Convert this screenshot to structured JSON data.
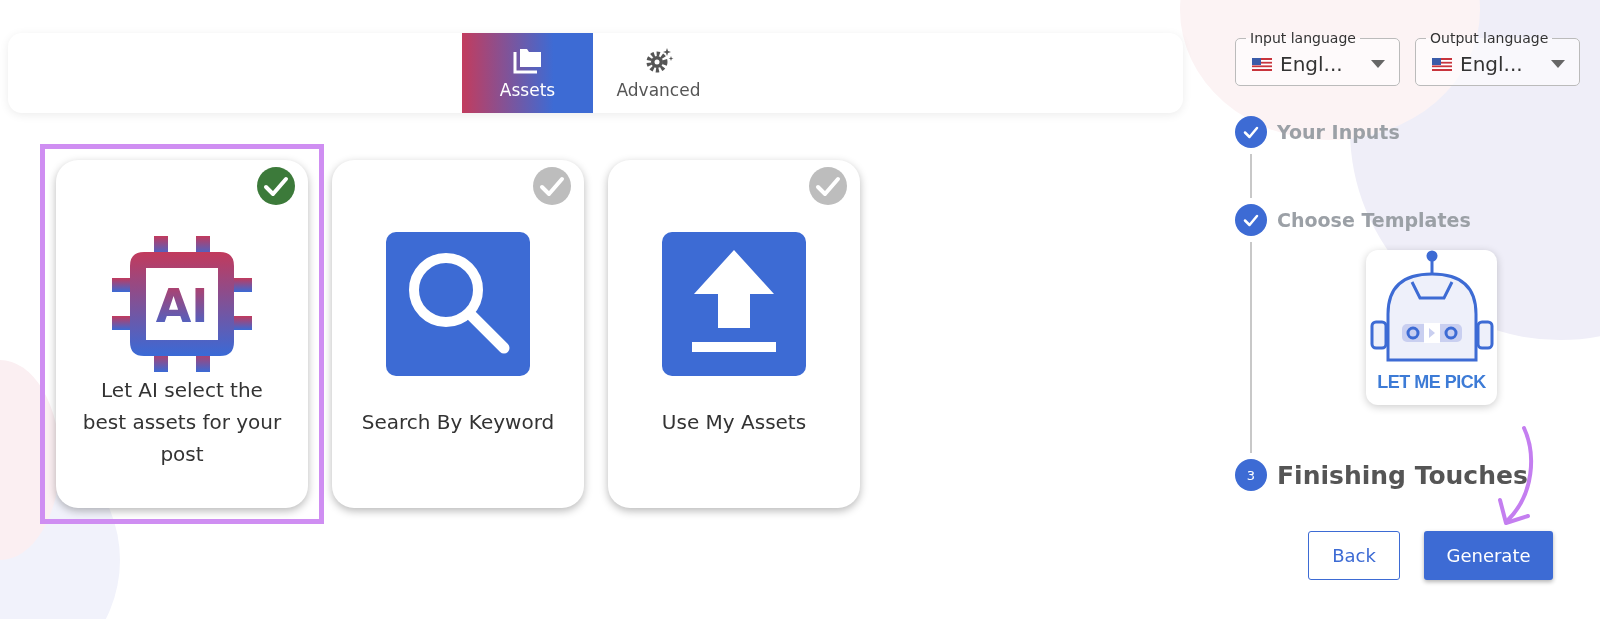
{
  "tabs": [
    {
      "label": "Assets",
      "kind": "folders",
      "selected": true
    },
    {
      "label": "Advanced",
      "kind": "gears",
      "selected": false
    }
  ],
  "options": [
    {
      "kind": "ai",
      "label": "Let AI select the best assets for your post",
      "icon_text": "AI",
      "checked": true,
      "highlighted": true
    },
    {
      "kind": "search",
      "label": "Search By Keyword",
      "checked": false,
      "highlighted": false
    },
    {
      "kind": "upload",
      "label": "Use My Assets",
      "checked": false,
      "highlighted": false
    }
  ],
  "languages": [
    {
      "label": "Input language",
      "value": "Engl..."
    },
    {
      "label": "Output language",
      "value": "Engl..."
    }
  ],
  "steps": [
    {
      "label": "Your Inputs",
      "completed": true
    },
    {
      "label": "Choose Templates",
      "completed": true,
      "template_label": "LET ME PICK"
    },
    {
      "label": "Finishing Touches",
      "completed": false,
      "number": "3"
    }
  ],
  "buttons": [
    {
      "label": "Back",
      "kind": "outline"
    },
    {
      "label": "Generate",
      "kind": "primary"
    }
  ]
}
